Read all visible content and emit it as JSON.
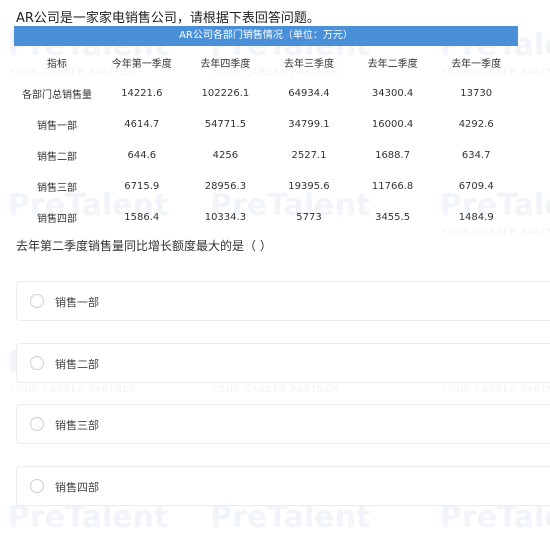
{
  "intro": "AR公司是一家家电销售公司，请根据下表回答问题。",
  "table": {
    "title": "AR公司各部门销售情况（单位：万元）",
    "headers": [
      "指标",
      "今年第一季度",
      "去年四季度",
      "去年三季度",
      "去年二季度",
      "去年一季度"
    ],
    "rows": [
      [
        "各部门总销售量",
        "14221.6",
        "102226.1",
        "64934.4",
        "34300.4",
        "13730"
      ],
      [
        "销售一部",
        "4614.7",
        "54771.5",
        "34799.1",
        "16000.4",
        "4292.6"
      ],
      [
        "销售二部",
        "644.6",
        "4256",
        "2527.1",
        "1688.7",
        "634.7"
      ],
      [
        "销售三部",
        "6715.9",
        "28956.3",
        "19395.6",
        "11766.8",
        "6709.4"
      ],
      [
        "销售四部",
        "1586.4",
        "10334.3",
        "5773",
        "3455.5",
        "1484.9"
      ]
    ]
  },
  "question": "去年第二季度销售量同比增长额度最大的是（ ）",
  "options": [
    {
      "label": "销售一部"
    },
    {
      "label": "销售二部"
    },
    {
      "label": "销售三部"
    },
    {
      "label": "销售四部"
    }
  ],
  "watermark": {
    "brand": "PreTalent",
    "tagline": "YOUR CAREER PARTNER"
  }
}
